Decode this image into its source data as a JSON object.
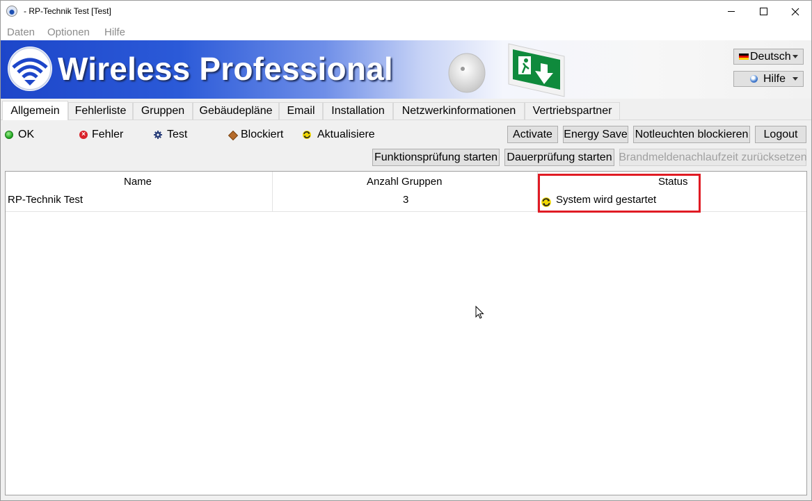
{
  "window": {
    "title": "- RP-Technik Test [Test]"
  },
  "menu": {
    "items": [
      "Daten",
      "Optionen",
      "Hilfe"
    ]
  },
  "banner": {
    "brand": "Wireless Professional",
    "language_button": "Deutsch",
    "help_button": "Hilfe"
  },
  "tabs": [
    "Allgemein",
    "Fehlerliste",
    "Gruppen",
    "Gebäudepläne",
    "Email",
    "Installation",
    "Netzwerkinformationen",
    "Vertriebspartner"
  ],
  "legend": {
    "ok": "OK",
    "error": "Fehler",
    "test": "Test",
    "blocked": "Blockiert",
    "updating": "Aktualisiere"
  },
  "actions": {
    "activate": "Activate",
    "energy_save": "Energy Save",
    "block_lights": "Notleuchten blockieren",
    "logout": "Logout",
    "function_test": "Funktionsprüfung starten",
    "duration_test": "Dauerprüfung starten",
    "reset_fire_alarm": "Brandmeldenachlaufzeit zurücksetzen"
  },
  "table": {
    "headers": [
      "Name",
      "Anzahl Gruppen",
      "Status"
    ],
    "rows": [
      {
        "name": "RP-Technik Test",
        "groups": "3",
        "status": "System wird gestartet"
      }
    ]
  },
  "colors": {
    "banner_blue": "#1d46c9",
    "highlight_red": "#e01b24",
    "disabled_text": "#a0a0a0"
  }
}
